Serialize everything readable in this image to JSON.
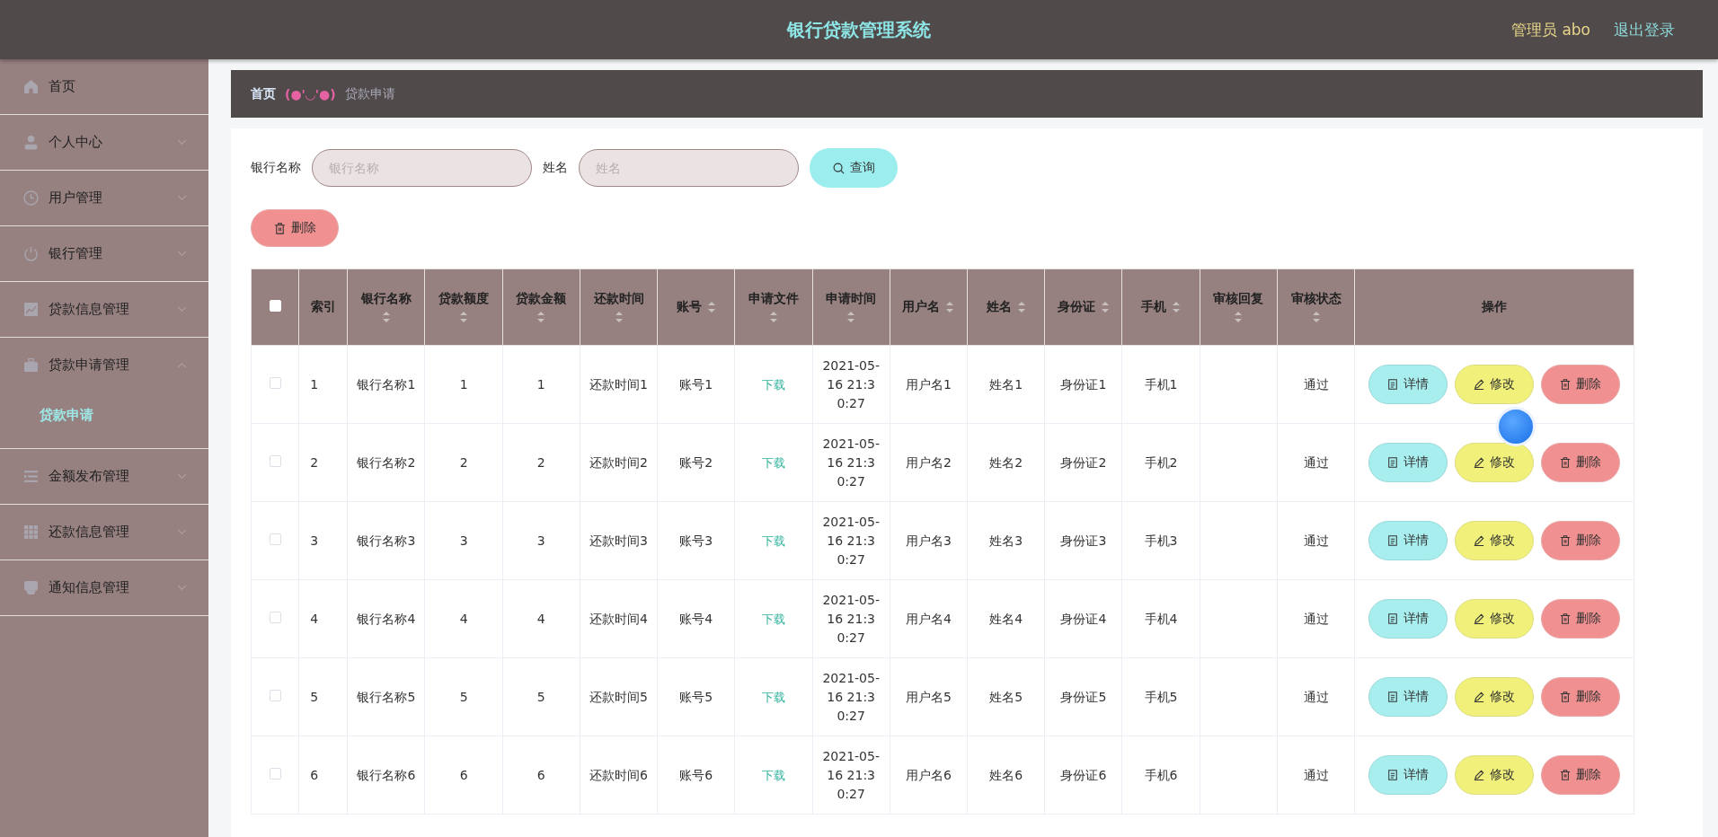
{
  "header": {
    "title": "银行贷款管理系统",
    "user": "管理员 abo",
    "logout": "退出登录"
  },
  "sidebar": {
    "items": [
      {
        "label": "首页",
        "kind": "link"
      },
      {
        "label": "个人中心",
        "kind": "submenu",
        "expanded": false
      },
      {
        "label": "用户管理",
        "kind": "submenu",
        "expanded": false
      },
      {
        "label": "银行管理",
        "kind": "submenu",
        "expanded": false
      },
      {
        "label": "贷款信息管理",
        "kind": "submenu",
        "expanded": false
      },
      {
        "label": "贷款申请管理",
        "kind": "submenu",
        "expanded": true,
        "children": [
          {
            "label": "贷款申请",
            "selected": true
          }
        ]
      },
      {
        "label": "金额发布管理",
        "kind": "submenu",
        "expanded": false
      },
      {
        "label": "还款信息管理",
        "kind": "submenu",
        "expanded": false
      },
      {
        "label": "通知信息管理",
        "kind": "submenu",
        "expanded": false
      }
    ]
  },
  "breadcrumb": {
    "home": "首页",
    "separator": "(●'◡'●)",
    "current": "贷款申请"
  },
  "search": {
    "fields": [
      {
        "label": "银行名称",
        "placeholder": "银行名称"
      },
      {
        "label": "姓名",
        "placeholder": "姓名"
      }
    ],
    "button": "查询"
  },
  "delete_button": "删除",
  "table": {
    "header_checked": false,
    "columns": [
      {
        "label": "索引",
        "sortable": false
      },
      {
        "label": "银行名称",
        "sortable": true
      },
      {
        "label": "贷款额度",
        "sortable": true
      },
      {
        "label": "贷款金额",
        "sortable": true
      },
      {
        "label": "还款时间",
        "sortable": true
      },
      {
        "label": "账号",
        "sortable": true
      },
      {
        "label": "申请文件",
        "sortable": true
      },
      {
        "label": "申请时间",
        "sortable": true
      },
      {
        "label": "用户名",
        "sortable": true
      },
      {
        "label": "姓名",
        "sortable": true
      },
      {
        "label": "身份证",
        "sortable": true
      },
      {
        "label": "手机",
        "sortable": true
      },
      {
        "label": "审核回复",
        "sortable": true
      },
      {
        "label": "审核状态",
        "sortable": true
      },
      {
        "label": "操作",
        "sortable": false
      }
    ],
    "rows": [
      {
        "checked": false,
        "index": "1",
        "bank_name": "银行名称1",
        "loan_limit": "1",
        "loan_amount": "1",
        "repay_time": "还款时间1",
        "account": "账号1",
        "file": "下载",
        "apply_time": "2021-05-16 21:30:27",
        "username": "用户名1",
        "name": "姓名1",
        "id_card": "身份证1",
        "phone": "手机1",
        "status": "通过",
        "actions": [
          {
            "label": "详情",
            "kind": "detail"
          },
          {
            "label": "修改",
            "kind": "edit"
          },
          {
            "label": "删除",
            "kind": "delete"
          }
        ]
      },
      {
        "checked": false,
        "index": "2",
        "bank_name": "银行名称2",
        "loan_limit": "2",
        "loan_amount": "2",
        "repay_time": "还款时间2",
        "account": "账号2",
        "file": "下载",
        "apply_time": "2021-05-16 21:30:27",
        "username": "用户名2",
        "name": "姓名2",
        "id_card": "身份证2",
        "phone": "手机2",
        "status": "通过",
        "actions": [
          {
            "label": "详情",
            "kind": "detail"
          },
          {
            "label": "修改",
            "kind": "edit"
          },
          {
            "label": "删除",
            "kind": "delete"
          }
        ]
      },
      {
        "checked": false,
        "index": "3",
        "bank_name": "银行名称3",
        "loan_limit": "3",
        "loan_amount": "3",
        "repay_time": "还款时间3",
        "account": "账号3",
        "file": "下载",
        "apply_time": "2021-05-16 21:30:27",
        "username": "用户名3",
        "name": "姓名3",
        "id_card": "身份证3",
        "phone": "手机3",
        "status": "通过",
        "actions": [
          {
            "label": "详情",
            "kind": "detail"
          },
          {
            "label": "修改",
            "kind": "edit"
          },
          {
            "label": "删除",
            "kind": "delete"
          }
        ]
      },
      {
        "checked": false,
        "index": "4",
        "bank_name": "银行名称4",
        "loan_limit": "4",
        "loan_amount": "4",
        "repay_time": "还款时间4",
        "account": "账号4",
        "file": "下载",
        "apply_time": "2021-05-16 21:30:27",
        "username": "用户名4",
        "name": "姓名4",
        "id_card": "身份证4",
        "phone": "手机4",
        "status": "通过",
        "actions": [
          {
            "label": "详情",
            "kind": "detail"
          },
          {
            "label": "修改",
            "kind": "edit"
          },
          {
            "label": "删除",
            "kind": "delete"
          }
        ]
      },
      {
        "checked": false,
        "index": "5",
        "bank_name": "银行名称5",
        "loan_limit": "5",
        "loan_amount": "5",
        "repay_time": "还款时间5",
        "account": "账号5",
        "file": "下载",
        "apply_time": "2021-05-16 21:30:27",
        "username": "用户名5",
        "name": "姓名5",
        "id_card": "身份证5",
        "phone": "手机5",
        "status": "通过",
        "actions": [
          {
            "label": "详情",
            "kind": "detail"
          },
          {
            "label": "修改",
            "kind": "edit"
          },
          {
            "label": "删除",
            "kind": "delete"
          }
        ]
      },
      {
        "checked": false,
        "index": "6",
        "bank_name": "银行名称6",
        "loan_limit": "6",
        "loan_amount": "6",
        "repay_time": "还款时间6",
        "account": "账号6",
        "file": "下载",
        "apply_time": "2021-05-16 21:30:27",
        "username": "用户名6",
        "name": "姓名6",
        "id_card": "身份证6",
        "phone": "手机6",
        "status": "通过",
        "actions": [
          {
            "label": "详情",
            "kind": "detail"
          },
          {
            "label": "修改",
            "kind": "edit"
          },
          {
            "label": "删除",
            "kind": "delete"
          }
        ]
      }
    ]
  }
}
